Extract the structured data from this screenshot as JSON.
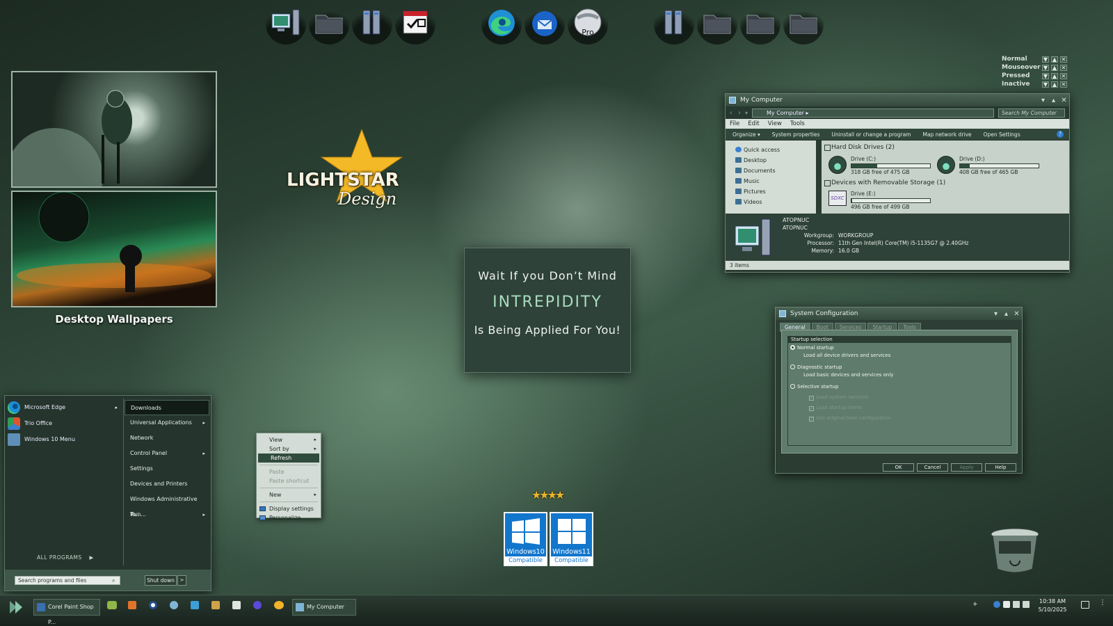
{
  "dock": {
    "items": [
      {
        "name": "my-computer-icon"
      },
      {
        "name": "folder-icon"
      },
      {
        "name": "system-icon"
      },
      {
        "name": "checklist-icon"
      },
      {
        "name": "edge-icon"
      },
      {
        "name": "thunderbird-icon"
      },
      {
        "name": "pro-icon",
        "label": "Pro"
      },
      {
        "name": "system-icon"
      },
      {
        "name": "folder-icon"
      },
      {
        "name": "folder-icon"
      },
      {
        "name": "folder-icon"
      }
    ]
  },
  "wallpapers": {
    "caption": "Desktop Wallpapers"
  },
  "logo": {
    "line1": "LIGHTSTAR",
    "line2": "Design"
  },
  "message": {
    "line1": "Wait If you Don’t Mind",
    "line2": "INTREPIDITY",
    "line3": "Is Being Applied For You!"
  },
  "legend": {
    "rows": [
      "Normal",
      "Mouseover",
      "Pressed",
      "Inactive"
    ],
    "glyphs": [
      "▼",
      "▲",
      "✕"
    ]
  },
  "my_computer": {
    "title": "My Computer",
    "address": "My Computer",
    "search_placeholder": "Search My Computer",
    "menu": [
      "File",
      "Edit",
      "View",
      "Tools"
    ],
    "commands": [
      "Organize ▾",
      "System properties",
      "Uninstall or change a program",
      "Map network drive",
      "Open Settings"
    ],
    "nav": [
      "Quick access",
      "Desktop",
      "Documents",
      "Music",
      "Pictures",
      "Videos"
    ],
    "groups": {
      "hdd": "Hard Disk Drives (2)",
      "removable": "Devices with Removable Storage (1)"
    },
    "drives": [
      {
        "name": "Drive (C:)",
        "free": "318 GB free of 475 GB",
        "used_fraction": 0.33
      },
      {
        "name": "Drive (D:)",
        "free": "408 GB free of 465 GB",
        "used_fraction": 0.12
      },
      {
        "name": "Drive (E:)",
        "free": "496 GB free of 499 GB",
        "used_fraction": 0.01,
        "icon_label": "SDXC"
      }
    ],
    "details": {
      "name": "ATOPNUC",
      "name2": "ATOPNUC",
      "workgroup_label": "Workgroup:",
      "workgroup": "WORKGROUP",
      "processor_label": "Processor:",
      "processor": "11th Gen Intel(R) Core(TM) i5-1135G7 @ 2.40GHz",
      "memory_label": "Memory:",
      "memory": "16.0 GB"
    },
    "status": "3 items"
  },
  "start_menu": {
    "left": [
      {
        "label": "Microsoft Edge",
        "arrow": "▸"
      },
      {
        "label": "Trio Office"
      },
      {
        "label": "Windows 10 Menu"
      }
    ],
    "right": [
      {
        "label": "Downloads",
        "selected": true
      },
      {
        "label": "Universal Applications",
        "arrow": "▸"
      },
      {
        "label": "Network"
      },
      {
        "label": "Control Panel",
        "arrow": "▸"
      },
      {
        "label": "Settings"
      },
      {
        "label": "Devices and Printers"
      },
      {
        "label": "Windows Administrative To...",
        "arrow": "▸"
      },
      {
        "label": "Run..."
      }
    ],
    "all_programs": "ALL PROGRAMS",
    "search_placeholder": "Search programs and files",
    "shutdown": "Shut down",
    "shutdown_arrow": ">"
  },
  "context_menu": {
    "items": [
      {
        "label": "View",
        "arrow": "▸"
      },
      {
        "label": "Sort by",
        "arrow": "▸"
      },
      {
        "label": "Refresh",
        "selected": true
      },
      {
        "sep": true
      },
      {
        "label": "Paste",
        "disabled": true
      },
      {
        "label": "Paste shortcut",
        "disabled": true
      },
      {
        "sep": true
      },
      {
        "label": "New",
        "arrow": "▸"
      },
      {
        "sep": true
      },
      {
        "label": "Display settings",
        "icon": "display-icon"
      },
      {
        "label": "Personalize",
        "icon": "personalize-icon"
      }
    ]
  },
  "sysconfig": {
    "title": "System Configuration",
    "tabs": [
      "General",
      "Boot",
      "Services",
      "Startup",
      "Tools"
    ],
    "group": "Startup selection",
    "normal": "Normal startup",
    "normal_desc": "Load all device drivers and services",
    "diagnostic": "Diagnostic startup",
    "diagnostic_desc": "Load basic devices and services only",
    "selective": "Selective startup",
    "checks": [
      "Load system services",
      "Load startup items",
      "Use original boot configuration"
    ],
    "buttons": [
      "OK",
      "Cancel",
      "Apply",
      "Help"
    ]
  },
  "badges": [
    {
      "line1": "Windows10",
      "line2": "Compatible"
    },
    {
      "line1": "Windows11",
      "line2": "Compatible"
    }
  ],
  "taskbar": {
    "apps": [
      {
        "label": "Corel Paint Shop P..."
      },
      {
        "label": "My Computer"
      }
    ],
    "time": "10:38 AM",
    "date": "5/10/2025"
  },
  "colors": {
    "accent": "#2f4b3d",
    "bg": "#2d4436",
    "badge": "#1276cc"
  }
}
